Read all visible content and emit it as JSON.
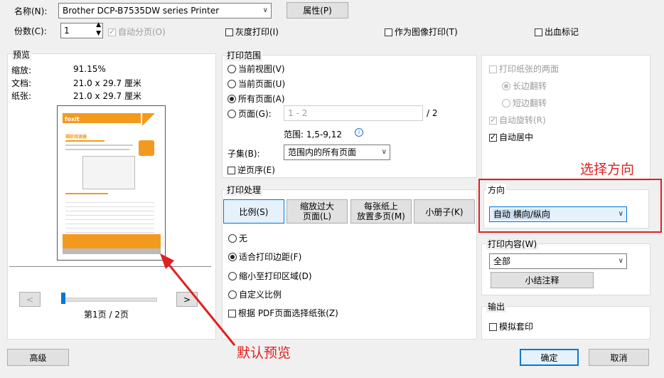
{
  "top": {
    "name_label": "名称(N):",
    "printer": "Brother DCP-B7535DW series Printer",
    "properties_button": "属性(P)",
    "copies_label": "份数(C):",
    "copies_value": "1",
    "collate_label": "自动分页(O)",
    "grayscale_label": "灰度打印(I)",
    "as_image_label": "作为图像打印(T)",
    "bleed_label": "出血标记"
  },
  "preview": {
    "title": "预览",
    "zoom_label": "缩放:",
    "zoom_value": "91.15%",
    "doc_label": "文档:",
    "doc_value": "21.0 x 29.7 厘米",
    "paper_label": "纸张:",
    "paper_value": "21.0 x 29.7 厘米",
    "prev_button": "<",
    "next_button": ">",
    "page_indicator": "第1页 / 2页",
    "thumb_brand": "foxit",
    "thumb_heading": "福昕阅读器"
  },
  "print_range": {
    "title": "打印范围",
    "current_view": "当前视图(V)",
    "current_page": "当前页面(U)",
    "all_pages": "所有页面(A)",
    "pages": "页面(G):",
    "pages_value": "1 - 2",
    "pages_total": "/ 2",
    "range_hint": "范围: 1,5-9,12",
    "subset_label": "子集(B):",
    "subset_value": "范围内的所有页面",
    "reverse_label": "逆页序(E)"
  },
  "handling": {
    "title": "打印处理",
    "tabs": [
      "比例(S)",
      "缩放过大\n页面(L)",
      "每张纸上\n放置多页(M)",
      "小册子(K)"
    ],
    "none": "无",
    "fit_margins": "适合打印边距(F)",
    "shrink": "缩小至打印区域(D)",
    "custom": "自定义比例",
    "pdf_paper": "根据 PDF页面选择纸张(Z)"
  },
  "duplex": {
    "both_sides": "打印纸张的两面",
    "long_edge": "长边翻转",
    "short_edge": "短边翻转",
    "auto_rotate": "自动旋转(R)",
    "auto_center": "自动居中"
  },
  "orientation": {
    "title": "方向",
    "value": "自动 横向/纵向"
  },
  "content": {
    "title": "打印内容(W)",
    "value": "全部",
    "summary_button": "小结注释"
  },
  "output": {
    "title": "输出",
    "simulate": "模拟套印"
  },
  "footer": {
    "advanced": "高级",
    "ok": "确定",
    "cancel": "取消"
  },
  "annotations": {
    "orientation_note": "选择方向",
    "preview_note": "默认预览"
  },
  "colors": {
    "accent": "#0078d7",
    "annotation_red": "#e02020",
    "foxit_orange": "#f39a1e"
  }
}
